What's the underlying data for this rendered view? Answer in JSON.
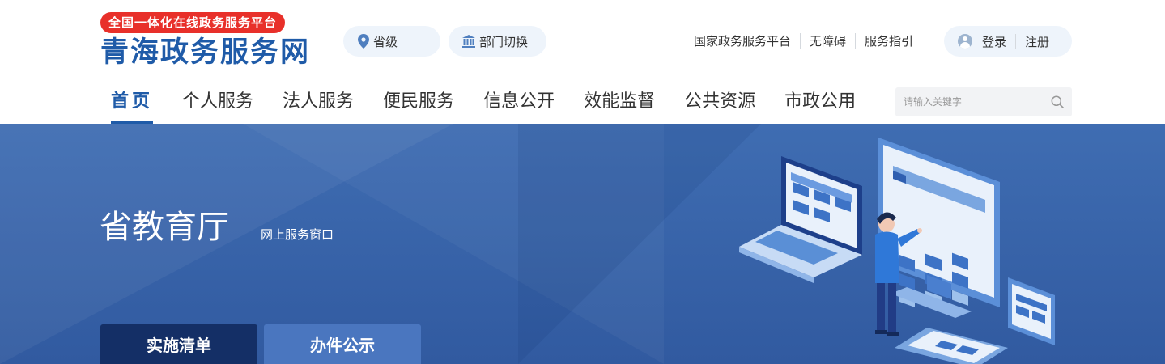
{
  "header": {
    "badge": "全国一体化在线政务服务平台",
    "site_title": "青海政务服务网",
    "region_label": "省级",
    "dept_switch_label": "部门切换",
    "top_links": [
      "国家政务服务平台",
      "无障碍",
      "服务指引"
    ],
    "login_label": "登录",
    "register_label": "注册"
  },
  "nav": {
    "items": [
      "首页",
      "个人服务",
      "法人服务",
      "便民服务",
      "信息公开",
      "效能监督",
      "公共资源",
      "市政公用"
    ],
    "active_index": 0
  },
  "search": {
    "placeholder": "请输入关键字",
    "value": ""
  },
  "banner": {
    "title": "省教育厅",
    "subtitle": "网上服务窗口",
    "tabs": [
      "实施清单",
      "办件公示"
    ],
    "active_tab_index": 0
  },
  "colors": {
    "brand_blue": "#1f5ba8",
    "badge_red": "#e8302a",
    "banner_blue": "#3f6db2",
    "tab_active": "#142f66",
    "tab_inactive": "#4a76bf"
  },
  "icons": [
    "location-pin-icon",
    "building-icon",
    "user-avatar-icon",
    "search-icon"
  ]
}
